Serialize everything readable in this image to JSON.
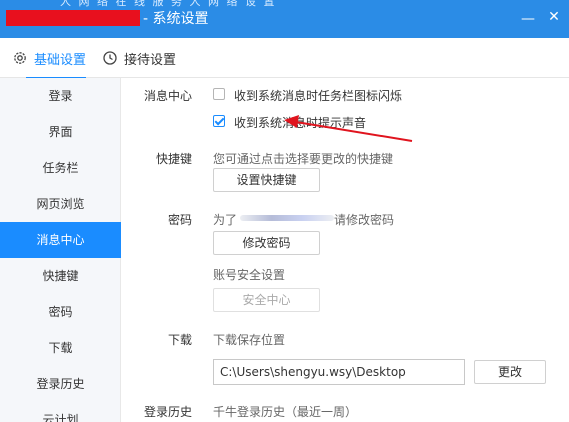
{
  "window": {
    "title": "- 系统设置",
    "faded_menu": "人 网 络   在 线   服 务   人 网 络   设 置",
    "minimize_glyph": "—",
    "close_glyph": "✕",
    "titlebar_color": "#2b8ce6",
    "redaction_color": "#e8101e"
  },
  "tabs": [
    {
      "label": "基础设置",
      "icon": "gear-icon",
      "active": true
    },
    {
      "label": "接待设置",
      "icon": "clock-icon",
      "active": false
    }
  ],
  "sidebar": {
    "items": [
      {
        "label": "登录"
      },
      {
        "label": "界面"
      },
      {
        "label": "任务栏"
      },
      {
        "label": "网页浏览"
      },
      {
        "label": "消息中心",
        "active": true
      },
      {
        "label": "快捷键"
      },
      {
        "label": "密码"
      },
      {
        "label": "下载"
      },
      {
        "label": "登录历史"
      },
      {
        "label": "云计划"
      }
    ]
  },
  "message_center": {
    "label": "消息中心",
    "option_flash": {
      "label": "收到系统消息时任务栏图标闪烁",
      "checked": false
    },
    "option_sound": {
      "label": "收到系统消息时提示声音",
      "checked": true
    }
  },
  "shortcut": {
    "label": "快捷键",
    "description": "您可通过点击选择要更改的快捷键",
    "button_label": "设置快捷键"
  },
  "password": {
    "label": "密码",
    "description_prefix": "为了",
    "description_suffix": "请修改密码",
    "change_button": "修改密码",
    "security_label": "账号安全设置",
    "security_button": "安全中心"
  },
  "download": {
    "label": "下载",
    "description": "下载保存位置",
    "path": "C:\\Users\\shengyu.wsy\\Desktop",
    "change_button": "更改"
  },
  "login_history": {
    "label": "登录历史",
    "description": "千牛登录历史（最近一周）"
  },
  "accent_color": "#1a8cff",
  "annotation_arrow_color": "#e0141e"
}
